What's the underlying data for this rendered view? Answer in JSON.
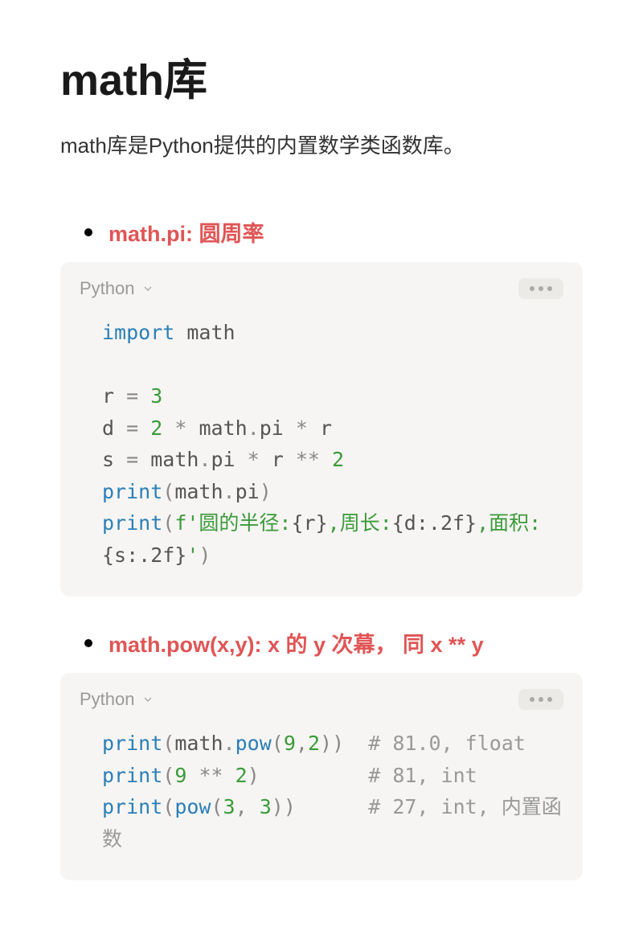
{
  "title": "math库",
  "description": "math库是Python提供的内置数学类函数库。",
  "sections": [
    {
      "heading": "math.pi: 圆周率",
      "lang": "Python",
      "code_tokens": [
        {
          "t": "import",
          "c": "kw"
        },
        {
          "t": " math\n\n",
          "c": "name"
        },
        {
          "t": "r ",
          "c": "name"
        },
        {
          "t": "=",
          "c": "op"
        },
        {
          "t": " ",
          "c": "name"
        },
        {
          "t": "3",
          "c": "num"
        },
        {
          "t": "\n",
          "c": "name"
        },
        {
          "t": "d ",
          "c": "name"
        },
        {
          "t": "=",
          "c": "op"
        },
        {
          "t": " ",
          "c": "name"
        },
        {
          "t": "2",
          "c": "num"
        },
        {
          "t": " ",
          "c": "name"
        },
        {
          "t": "*",
          "c": "op"
        },
        {
          "t": " math",
          "c": "name"
        },
        {
          "t": ".",
          "c": "op"
        },
        {
          "t": "pi ",
          "c": "name"
        },
        {
          "t": "*",
          "c": "op"
        },
        {
          "t": " r\n",
          "c": "name"
        },
        {
          "t": "s ",
          "c": "name"
        },
        {
          "t": "=",
          "c": "op"
        },
        {
          "t": " math",
          "c": "name"
        },
        {
          "t": ".",
          "c": "op"
        },
        {
          "t": "pi ",
          "c": "name"
        },
        {
          "t": "*",
          "c": "op"
        },
        {
          "t": " r ",
          "c": "name"
        },
        {
          "t": "**",
          "c": "op"
        },
        {
          "t": " ",
          "c": "name"
        },
        {
          "t": "2",
          "c": "num"
        },
        {
          "t": "\n",
          "c": "name"
        },
        {
          "t": "print",
          "c": "fn"
        },
        {
          "t": "(",
          "c": "paren"
        },
        {
          "t": "math",
          "c": "name"
        },
        {
          "t": ".",
          "c": "op"
        },
        {
          "t": "pi",
          "c": "name"
        },
        {
          "t": ")",
          "c": "paren"
        },
        {
          "t": "\n",
          "c": "name"
        },
        {
          "t": "print",
          "c": "fn"
        },
        {
          "t": "(",
          "c": "paren"
        },
        {
          "t": "f'圆的半径:",
          "c": "str"
        },
        {
          "t": "{r}",
          "c": "fstr-expr"
        },
        {
          "t": ",周长:",
          "c": "str"
        },
        {
          "t": "{d:.2f}",
          "c": "fstr-expr"
        },
        {
          "t": ",面积:",
          "c": "str"
        },
        {
          "t": "{s:.2f}",
          "c": "fstr-expr"
        },
        {
          "t": "'",
          "c": "str"
        },
        {
          "t": ")",
          "c": "paren"
        }
      ]
    },
    {
      "heading": "math.pow(x,y):  x 的 y 次幕， 同 x ** y",
      "lang": "Python",
      "code_tokens": [
        {
          "t": "print",
          "c": "fn"
        },
        {
          "t": "(",
          "c": "paren"
        },
        {
          "t": "math",
          "c": "name"
        },
        {
          "t": ".",
          "c": "op"
        },
        {
          "t": "pow",
          "c": "fn"
        },
        {
          "t": "(",
          "c": "paren"
        },
        {
          "t": "9",
          "c": "num"
        },
        {
          "t": ",",
          "c": "op"
        },
        {
          "t": "2",
          "c": "num"
        },
        {
          "t": "))",
          "c": "paren"
        },
        {
          "t": "  ",
          "c": "name"
        },
        {
          "t": "# 81.0, float",
          "c": "comment"
        },
        {
          "t": "\n",
          "c": "name"
        },
        {
          "t": "print",
          "c": "fn"
        },
        {
          "t": "(",
          "c": "paren"
        },
        {
          "t": "9",
          "c": "num"
        },
        {
          "t": " ",
          "c": "name"
        },
        {
          "t": "**",
          "c": "op"
        },
        {
          "t": " ",
          "c": "name"
        },
        {
          "t": "2",
          "c": "num"
        },
        {
          "t": ")",
          "c": "paren"
        },
        {
          "t": "         ",
          "c": "name"
        },
        {
          "t": "# 81, int",
          "c": "comment"
        },
        {
          "t": "\n",
          "c": "name"
        },
        {
          "t": "print",
          "c": "fn"
        },
        {
          "t": "(",
          "c": "paren"
        },
        {
          "t": "pow",
          "c": "fn"
        },
        {
          "t": "(",
          "c": "paren"
        },
        {
          "t": "3",
          "c": "num"
        },
        {
          "t": ",",
          "c": "op"
        },
        {
          "t": " ",
          "c": "name"
        },
        {
          "t": "3",
          "c": "num"
        },
        {
          "t": "))",
          "c": "paren"
        },
        {
          "t": "      ",
          "c": "name"
        },
        {
          "t": "# 27, int, 内置函数",
          "c": "comment"
        }
      ]
    }
  ]
}
